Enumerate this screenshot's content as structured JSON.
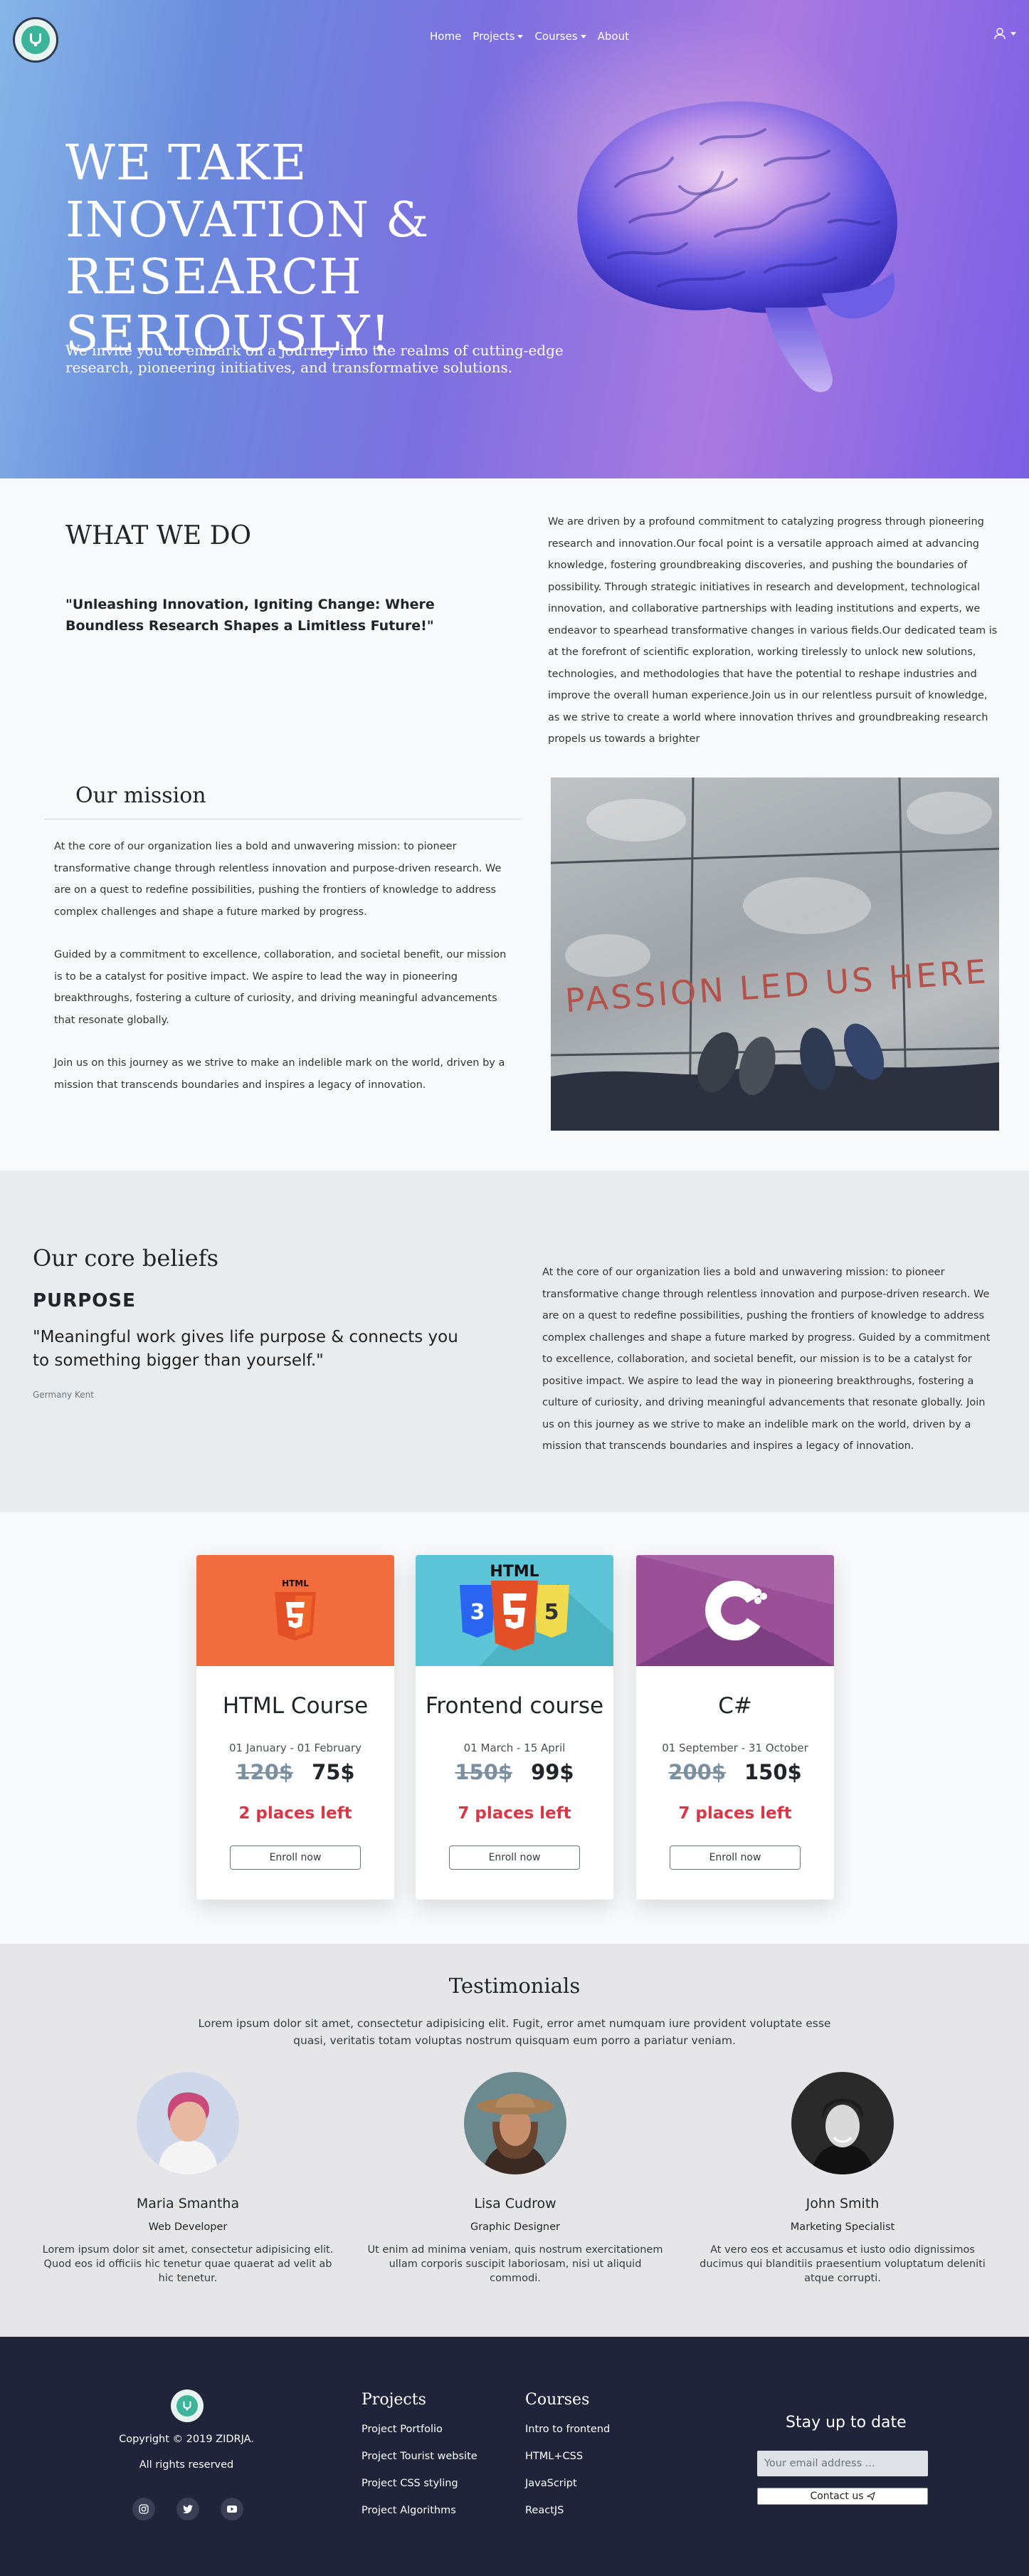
{
  "nav": {
    "logo_text": "ZIDRJA",
    "links": [
      {
        "label": "Home"
      },
      {
        "label": "Projects"
      },
      {
        "label": "Courses"
      },
      {
        "label": "About"
      }
    ]
  },
  "hero": {
    "title": "WE TAKE INOVATION & RESEARCH SERIOUSLY!",
    "subtitle": "We invite you to embark on a journey into the realms of cutting-edge research, pioneering initiatives, and transformative solutions."
  },
  "what_we_do": {
    "title": "WHAT WE DO",
    "quote": "\"Unleashing Innovation, Igniting Change: Where Boundless Research Shapes a Limitless Future!\"",
    "text": "We are driven by a profound commitment to catalyzing progress through pioneering research and innovation.Our focal point is a versatile approach aimed at advancing knowledge, fostering groundbreaking discoveries, and pushing the boundaries of possibility. Through strategic initiatives in research and development, technological innovation, and collaborative partnerships with leading institutions and experts, we endeavor to spearhead transformative changes in various fields.Our dedicated team is at the forefront of scientific exploration, working tirelessly to unlock new solutions, technologies, and methodologies that have the potential to reshape industries and improve the overall human experience.Join us in our relentless pursuit of knowledge, as we strive to create a world where innovation thrives and groundbreaking research propels us towards a brighter"
  },
  "mission": {
    "title": "Our mission",
    "paragraphs": [
      "At the core of our organization lies a bold and unwavering mission: to pioneer transformative change through relentless innovation and purpose-driven research. We are on a quest to redefine possibilities, pushing the frontiers of knowledge to address complex challenges and shape a future marked by progress.",
      "Guided by a commitment to excellence, collaboration, and societal benefit, our mission is to be a catalyst for positive impact. We aspire to lead the way in pioneering breakthroughs, fostering a culture of curiosity, and driving meaningful advancements that resonate globally.",
      "Join us on this journey as we strive to make an indelible mark on the world, driven by a mission that transcends boundaries and inspires a legacy of innovation."
    ],
    "image_text": "PASSION LED US HERE"
  },
  "beliefs": {
    "title": "Our core beliefs",
    "purpose": "PURPOSE",
    "quote": "\"Meaningful work gives life purpose & connects you to something bigger than yourself.\"",
    "author": "Germany Kent",
    "text": "At the core of our organization lies a bold and unwavering mission: to pioneer transformative change through relentless innovation and purpose-driven research. We are on a quest to redefine possibilities, pushing the frontiers of knowledge to address complex challenges and shape a future marked by progress. Guided by a commitment to excellence, collaboration, and societal benefit, our mission is to be a catalyst for positive impact. We aspire to lead the way in pioneering breakthroughs, fostering a culture of curiosity, and driving meaningful advancements that resonate globally. Join us on this journey as we strive to make an indelible mark on the world, driven by a mission that transcends boundaries and inspires a legacy of innovation."
  },
  "courses": [
    {
      "title": "HTML Course",
      "dates": "01 January - 01 February",
      "old_price": "120$",
      "price": "75$",
      "places": "2 places left",
      "button": "Enroll now",
      "img_label": "HTML",
      "img_color": "#f26d3d"
    },
    {
      "title": "Frontend course",
      "dates": "01 March - 15 April",
      "old_price": "150$",
      "price": "99$",
      "places": "7 places left",
      "button": "Enroll now",
      "img_label": "HTML",
      "img_color": "#5cc6d8"
    },
    {
      "title": "C#",
      "dates": "01 September - 31 October",
      "old_price": "200$",
      "price": "150$",
      "places": "7 places left",
      "button": "Enroll now",
      "img_label": "",
      "img_color": "#9b4f96"
    }
  ],
  "testimonials": {
    "title": "Testimonials",
    "intro": "Lorem ipsum dolor sit amet, consectetur adipisicing elit. Fugit, error amet numquam iure provident voluptate esse quasi, veritatis totam voluptas nostrum quisquam eum porro a pariatur veniam.",
    "people": [
      {
        "name": "Maria Smantha",
        "role": "Web Developer",
        "text": "Lorem ipsum dolor sit amet, consectetur adipisicing elit. Quod eos id officiis hic tenetur quae quaerat ad velit ab hic tenetur."
      },
      {
        "name": "Lisa Cudrow",
        "role": "Graphic Designer",
        "text": "Ut enim ad minima veniam, quis nostrum exercitationem ullam corporis suscipit laboriosam, nisi ut aliquid commodi."
      },
      {
        "name": "John Smith",
        "role": "Marketing Specialist",
        "text": "At vero eos et accusamus et iusto odio dignissimos ducimus qui blanditiis praesentium voluptatum deleniti atque corrupti."
      }
    ]
  },
  "footer": {
    "copyright": "Copyright © 2019 ZIDRJA.",
    "rights": "All rights reserved",
    "projects_title": "Projects",
    "projects": [
      "Project Portfolio",
      "Project Tourist website",
      "Project CSS styling",
      "Project Algorithms"
    ],
    "courses_title": "Courses",
    "courses": [
      "Intro to frontend",
      "HTML+CSS",
      "JavaScript",
      "ReactJS"
    ],
    "stay_title": "Stay up to date",
    "email_placeholder": "Your email address ...",
    "contact_label": "Contact us"
  }
}
